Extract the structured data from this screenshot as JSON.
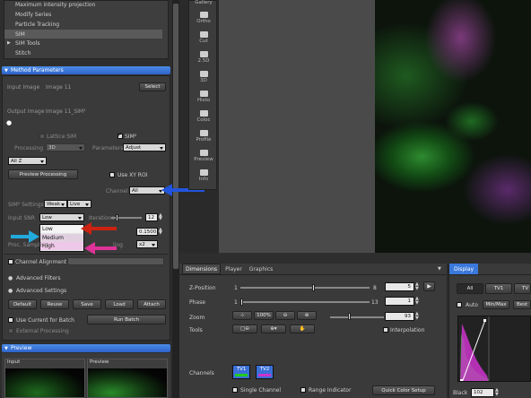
{
  "top_list": {
    "items": [
      "Maximum intensity projection",
      "Modify Series",
      "Particle Tracking",
      "SIM",
      "SIM Tools",
      "Stitch"
    ]
  },
  "method": {
    "header": "Method Parameters",
    "input_label": "Input Image",
    "input_value": "Image 11",
    "select_btn": "Select",
    "output_label": "Output Image",
    "output_value": "Image 11_SIM²",
    "lattice_sim": "Lattice SIM",
    "sim2": "SIM²",
    "processing_label": "Processing",
    "processing_value": "3D",
    "parameters_label": "Parameters",
    "parameters_value": "Adjust",
    "allz_value": "All Z",
    "preview_btn": "Preview Processing",
    "use_xy_roi": "Use XY ROI",
    "channel_label": "Channel",
    "channel_value": "All",
    "sim2_settings_label": "SIM² Settings",
    "sim2_settings_value": "Weak",
    "sim2_live_value": "Live",
    "input_snr_label": "Input SNR",
    "input_snr_value": "Low",
    "iterations_label": "Iterations",
    "iterations_value": "12",
    "snr_options": [
      "Low",
      "Medium",
      "High"
    ],
    "regularization_value": "0.1500",
    "proc_sampling_label": "Proc. Sampling",
    "sampling_suffix": "ling",
    "sampling_value": "x2",
    "channel_alignment": "Channel Alignment",
    "advanced_filters": "Advanced Filters",
    "advanced_settings": "Advanced Settings",
    "buttons": [
      "Default",
      "Reuse",
      "Save",
      "Load",
      "Attach"
    ],
    "use_current_batch": "Use Current for Batch",
    "run_batch": "Run Batch",
    "external_processing": "External Processing"
  },
  "preview": {
    "header": "Preview",
    "input": "Input",
    "preview": "Preview"
  },
  "toolbar_icons": [
    "Gallery",
    "Ortho",
    "Cut",
    "2.5D",
    "3D",
    "Histo",
    "Coloc",
    "Profile",
    "Preview",
    "Info"
  ],
  "dimensions": {
    "tabs": [
      "Dimensions",
      "Player",
      "Graphics"
    ],
    "zpos_label": "Z-Position",
    "zpos_min": "1",
    "zpos_max": "8",
    "zpos_value": "5",
    "zpos_level": 0.57,
    "phase_label": "Phase",
    "phase_min": "1",
    "phase_max": "13",
    "phase_value": "1",
    "zoom_label": "Zoom",
    "zoom_percent": "100%",
    "zoom_value": "93",
    "zoom_level": 0.4,
    "tools_label": "Tools",
    "interpolation": "Interpolation",
    "channels_label": "Channels",
    "tv1": "TV1",
    "tv2": "TV2",
    "single_channel": "Single Channel",
    "range_indicator": "Range Indicator",
    "quick_color": "Quick Color Setup"
  },
  "display": {
    "tab": "Display",
    "channel_tabs": [
      "All",
      "TV1",
      "TV"
    ],
    "auto": "Auto",
    "minmax": "Min/Max",
    "best": "Best",
    "black_label": "Black",
    "black_value": "102"
  },
  "colors": {
    "accent": "#3b78dc",
    "arrow_blue": "#2255dd",
    "arrow_red": "#cc2211",
    "arrow_cyan": "#22aadd",
    "arrow_pink": "#dd3399"
  }
}
